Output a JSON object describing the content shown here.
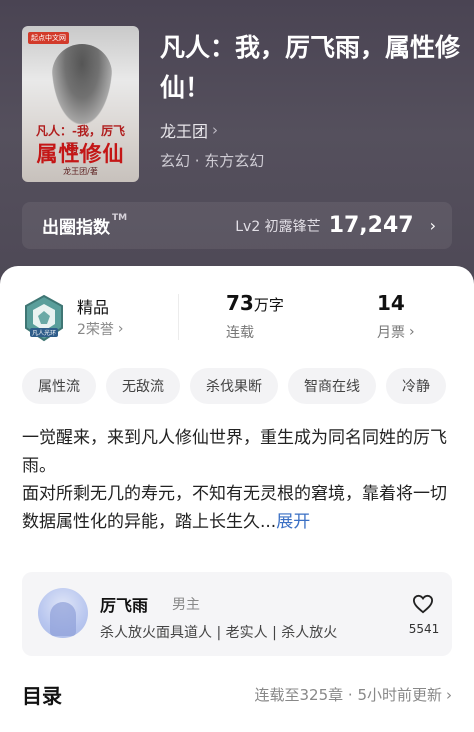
{
  "book": {
    "title": "凡人：我，厉飞雨，属性修仙！",
    "author": "龙王团",
    "genre": "玄幻 · 东方玄幻",
    "cover": {
      "publisher_tag": "起点中文网",
      "line1": "凡人：",
      "line1b": "-我，厉飞雨，-",
      "line2": "属性修仙",
      "author_credit": "龙王团/著"
    }
  },
  "index": {
    "label": "出圈指数",
    "tm": "TM",
    "level": "Lv2 初露锋芒",
    "value": "17,247"
  },
  "honors": {
    "title": "精品",
    "subtitle": "2荣誉",
    "badge_text": "凡人光环"
  },
  "stats": {
    "words_value": "73",
    "words_unit": "万字",
    "words_label": "连载",
    "tickets_value": "14",
    "tickets_label": "月票"
  },
  "tags": [
    "属性流",
    "无敌流",
    "杀伐果断",
    "智商在线",
    "冷静"
  ],
  "description": {
    "line1": "一觉醒来，来到凡人修仙世界，重生成为同名同姓的厉飞雨。",
    "line2": "面对所剩无几的寿元，不知有无灵根的窘境，靠着将一切数据属性化的异能，踏上长生久...",
    "more": "展开"
  },
  "protagonist": {
    "name": "厉飞雨",
    "role": "男主",
    "traits": "杀人放火面具道人 | 老实人 | 杀人放火",
    "likes": "5541"
  },
  "toc": {
    "title": "目录",
    "status": "连载至325章 · 5小时前更新"
  },
  "colors": {
    "hero_bg": "#4d4855",
    "link_blue": "#3a6fc4",
    "badge_teal": "#4a8f8f"
  }
}
